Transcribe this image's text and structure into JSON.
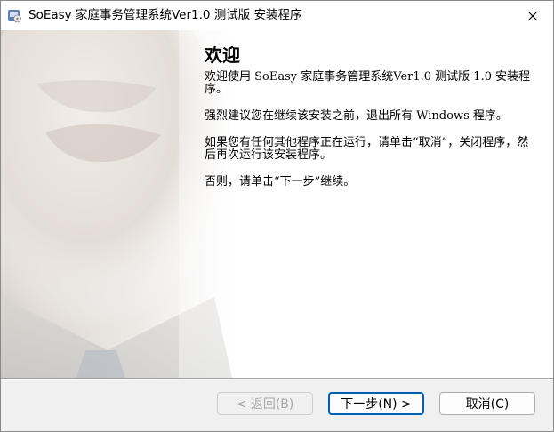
{
  "window": {
    "title": "SoEasy 家庭事务管理系统Ver1.0 测试版 安装程序"
  },
  "welcome": {
    "heading": "欢迎",
    "paragraphs": [
      "欢迎使用 SoEasy 家庭事务管理系统Ver1.0 测试版 1.0 安装程序。",
      "强烈建议您在继续该安装之前，退出所有 Windows 程序。",
      "如果您有任何其他程序正在运行，请单击“取消”，关闭程序，然后再次运行该安装程序。",
      "否则，请单击“下一步”继续。"
    ]
  },
  "buttons": {
    "back_label": "< 返回(B)",
    "next_label": "下一步(N) >",
    "cancel_label": "取消(C)"
  },
  "icons": {
    "app": "installer-icon",
    "close": "close-icon"
  }
}
